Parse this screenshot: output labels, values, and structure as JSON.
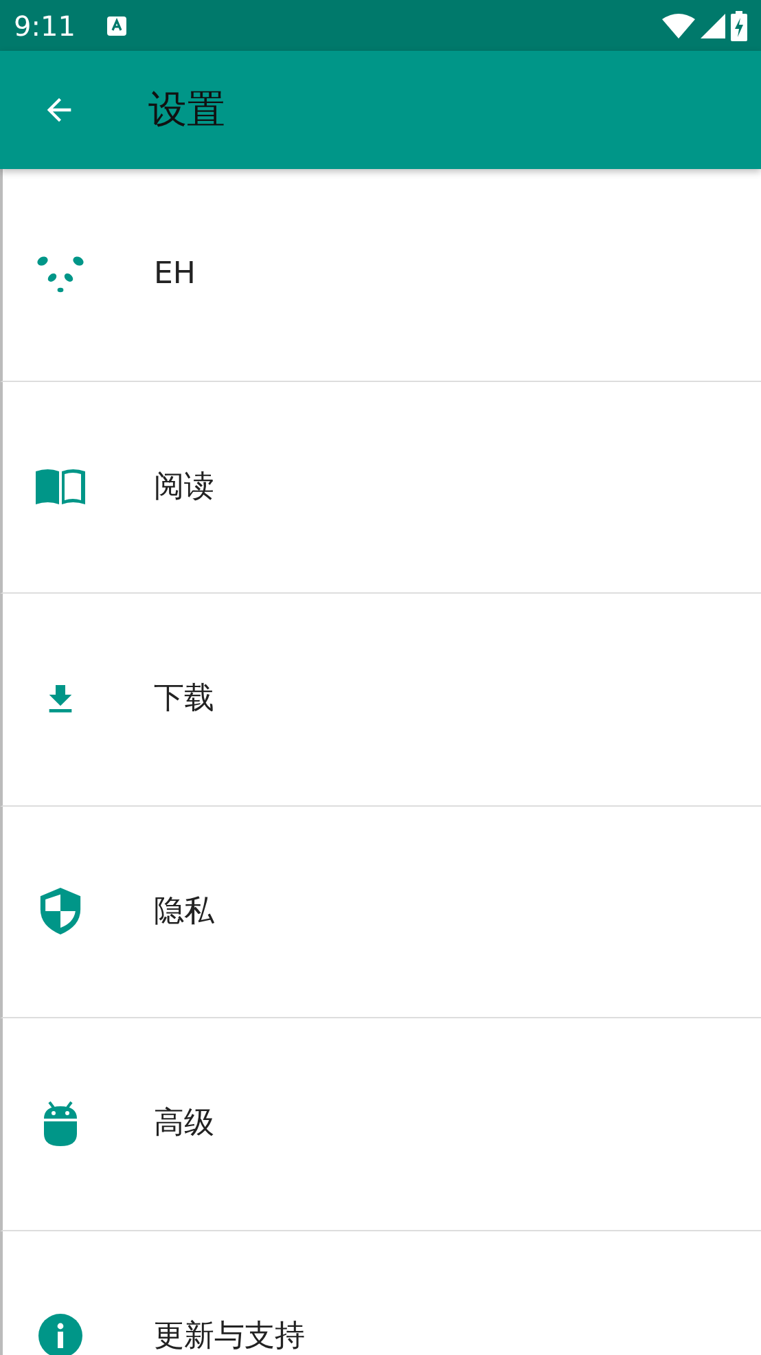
{
  "status_bar": {
    "time": "9:11"
  },
  "app_bar": {
    "title": "设置"
  },
  "items": [
    {
      "label": "EH"
    },
    {
      "label": "阅读"
    },
    {
      "label": "下载"
    },
    {
      "label": "隐私"
    },
    {
      "label": "高级"
    },
    {
      "label": "更新与支持"
    }
  ]
}
